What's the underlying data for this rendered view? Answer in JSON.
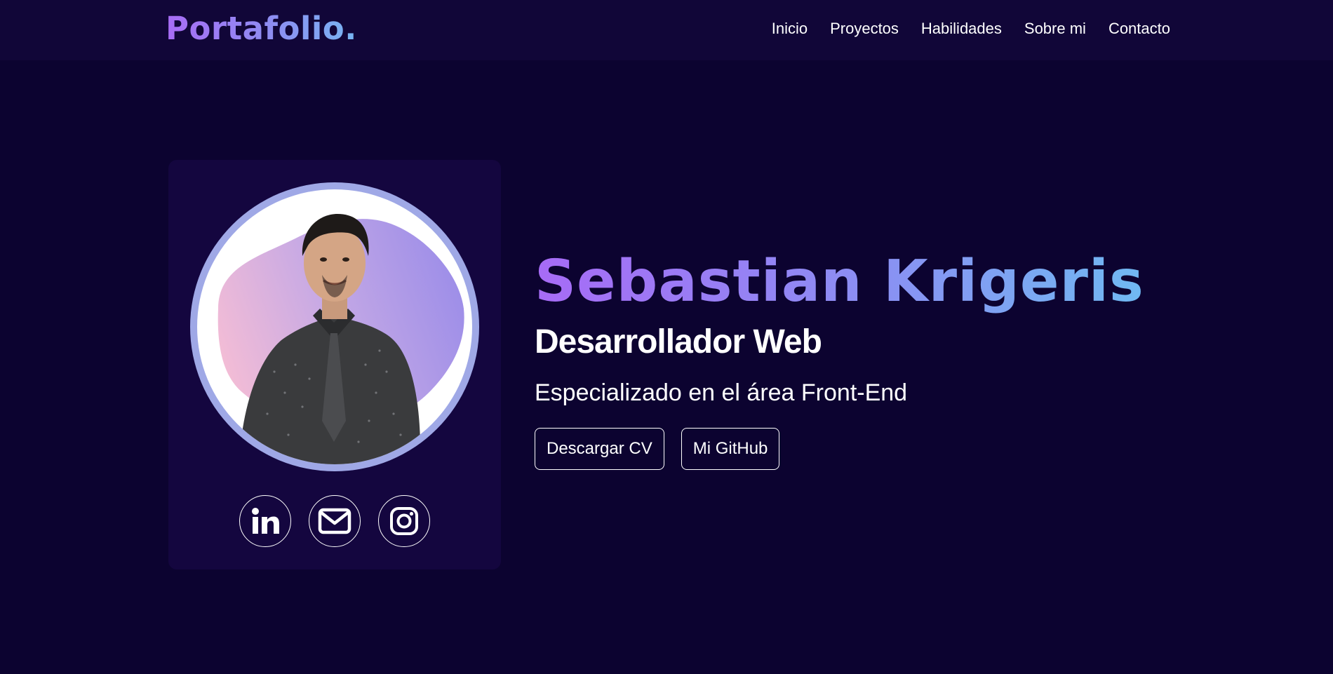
{
  "brand": {
    "logo": "Portafolio."
  },
  "nav": {
    "items": [
      {
        "label": "Inicio"
      },
      {
        "label": "Proyectos"
      },
      {
        "label": "Habilidades"
      },
      {
        "label": "Sobre mi"
      },
      {
        "label": "Contacto"
      }
    ]
  },
  "hero": {
    "name": "Sebastian Krigeris",
    "role": "Desarrollador Web",
    "subtitle": "Especializado en el área Front-End",
    "buttons": {
      "cv": "Descargar CV",
      "github": "Mi GitHub"
    }
  },
  "profile": {
    "avatar": "profile-photo",
    "socials": [
      {
        "icon": "linkedin-icon"
      },
      {
        "icon": "email-icon"
      },
      {
        "icon": "instagram-icon"
      }
    ]
  },
  "colors": {
    "background": "#0c0330",
    "navbar": "#110638",
    "card": "#14063f",
    "gradient_start": "#a76bf6",
    "gradient_end": "#70b9f2",
    "avatar_ring": "#9fa8e6"
  }
}
